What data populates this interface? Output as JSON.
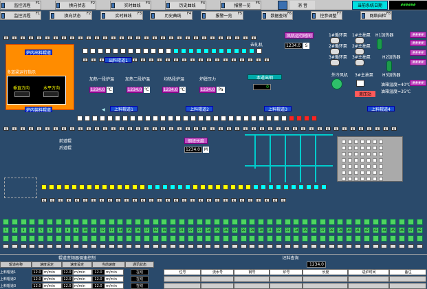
{
  "toolbar": {
    "buttons": [
      {
        "label": "监控流程",
        "key": "F1"
      },
      {
        "label": "换向状态",
        "key": "F2"
      },
      {
        "label": "实时曲线",
        "key": "F3"
      },
      {
        "label": "历史曲线",
        "key": "F4"
      },
      {
        "label": "报警一览",
        "key": "F5"
      }
    ],
    "alarm_text": "消 音",
    "right_buttons": [
      {
        "label": "数据查询",
        "key": "F6"
      },
      {
        "label": "控参调整",
        "key": "F7"
      },
      {
        "label": "网络自检",
        "key": "F8"
      }
    ],
    "sysdate_label": "当前系统日期",
    "clock": "######"
  },
  "furnace": {
    "multi_label": "多道梁运行指示",
    "vertical_dir": "垂直方向",
    "horizontal_dir": "水平方向",
    "furnace_out_label": "炉内出料辊道",
    "furnace_in_label": "炉内装料辊道",
    "top_label": "出料辊道1",
    "feed_label1": "上料辊道1",
    "feed_label2": "上料辊道2",
    "feed_label3": "上料辊道3",
    "feed_label4": "上料辊道4",
    "fan_section_label": "风机运行时间",
    "exit_label": "去轧机",
    "exit_value": "1234.0",
    "exit_unit": "S",
    "front_track": "前道辊",
    "rear_track": "后道辊"
  },
  "temps": {
    "labels": [
      "加热一段炉温",
      "加热二段炉温",
      "均热段炉温",
      "炉膛压力"
    ],
    "values": [
      "1234.0",
      "1234.0",
      "1234.0",
      "1234.0"
    ],
    "units": [
      "℃",
      "℃",
      "℃",
      "Pa"
    ],
    "exit_label": "本道出钢",
    "exit_value": "0"
  },
  "mid": {
    "mag_label": "钢坯长度",
    "value": "1234.0",
    "unit": "M"
  },
  "right_panel": {
    "fans": [
      "1#循环泵",
      "1#主抽泵",
      "2#循环泵",
      "2#主抽泵",
      "3#循环泵",
      "3#主抽泵"
    ],
    "h1": "H1加热器",
    "h2": "H2加热器",
    "h3": "H3加热器",
    "cooling_fan": "外冷风机",
    "main_pump": "3#主抽泵",
    "hydraulic": "液压站",
    "oil_temp1": "油箱温度=40℃",
    "oil_temp2": "油箱温度=35℃",
    "side_tags": [
      "####",
      "####",
      "####",
      "####",
      "####"
    ]
  },
  "numbers_row": [
    "1",
    "2",
    "3",
    "4",
    "5",
    "6",
    "7",
    "8",
    "9",
    "10",
    "11",
    "12",
    "13",
    "14",
    "15",
    "16",
    "17",
    "18",
    "19",
    "20",
    "21",
    "22",
    "23",
    "24",
    "25",
    "26",
    "27",
    "28",
    "29",
    "30",
    "31",
    "32",
    "33",
    "34",
    "35",
    "36",
    "37",
    "38",
    "39",
    "40",
    "41",
    "42",
    "43",
    "44",
    "45",
    "46",
    "47",
    "48"
  ],
  "bottom_left": {
    "title": "辊道变频器调速控制",
    "headers": [
      "辊道名称",
      "速度设定",
      "速度设定",
      "当前速度",
      "通讯状态"
    ],
    "rows": [
      {
        "name": "上料辊道1",
        "set1": "12.0",
        "unit1": "m/min",
        "set2": "12.0",
        "unit2": "m/min",
        "cur": "12.0",
        "unit3": "m/min",
        "status": "在线"
      },
      {
        "name": "上料辊道2",
        "set1": "12.0",
        "unit1": "m/min",
        "set2": "12.0",
        "unit2": "m/min",
        "cur": "12.0",
        "unit3": "m/min",
        "status": "在线"
      },
      {
        "name": "上料辊道3",
        "set1": "12.0",
        "unit1": "m/min",
        "set2": "12.0",
        "unit2": "m/min",
        "cur": "12.0",
        "unit3": "m/min",
        "status": "在线"
      }
    ]
  },
  "bottom_right": {
    "title": "坯料查询",
    "top_value": "1234.0",
    "headers": [
      "位号",
      "流水号",
      "钢号",
      "炉号",
      "长度",
      "进炉时间",
      "备注"
    ]
  }
}
